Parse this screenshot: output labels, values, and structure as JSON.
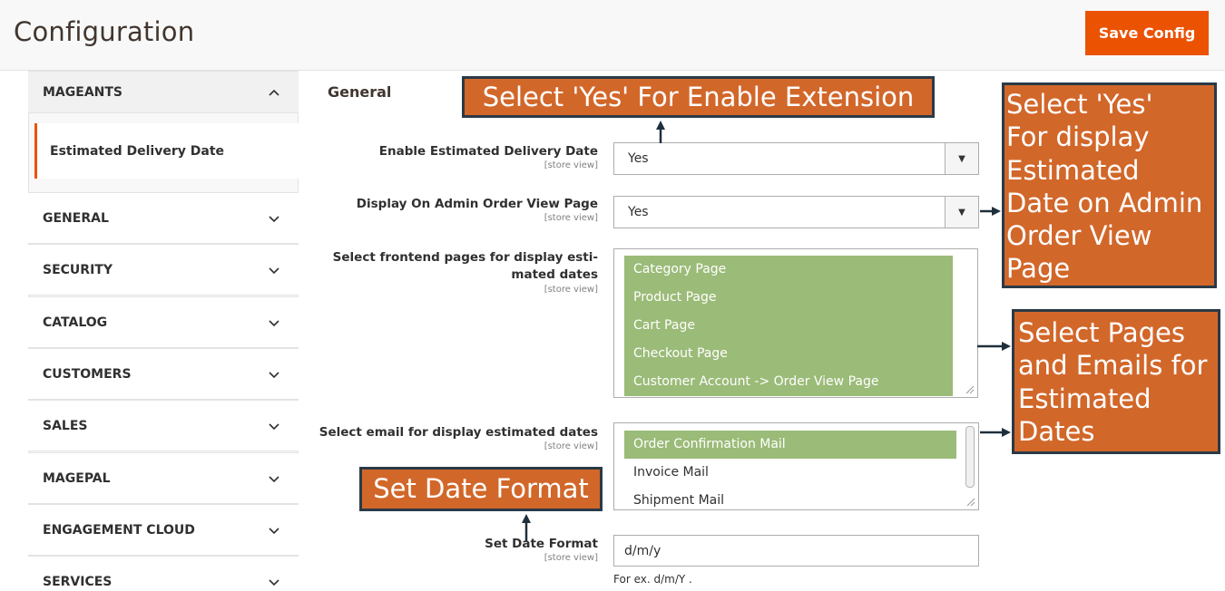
{
  "header": {
    "title": "Configuration",
    "save_label": "Save Config"
  },
  "sidebar": {
    "tabs": [
      {
        "label": "MAGEANTS",
        "expanded": true
      },
      {
        "label": "GENERAL"
      },
      {
        "label": "SECURITY"
      },
      {
        "label": "CATALOG"
      },
      {
        "label": "CUSTOMERS"
      },
      {
        "label": "SALES"
      },
      {
        "label": "MAGEPAL"
      },
      {
        "label": "ENGAGEMENT CLOUD"
      },
      {
        "label": "SERVICES"
      }
    ],
    "active_item": "Estimated Delivery Date"
  },
  "main": {
    "section_title": "General",
    "fields": {
      "enable": {
        "label": "Enable Estimated Delivery Date",
        "scope": "[store view]",
        "value": "Yes"
      },
      "admin_view": {
        "label": "Display On Admin Order View Page",
        "scope": "[store view]",
        "value": "Yes"
      },
      "pages": {
        "label_line1": "Select frontend pages for display esti-",
        "label_line2": "mated dates",
        "scope": "[store view]",
        "options": [
          "Category Page",
          "Product Page",
          "Cart Page",
          "Checkout Page",
          "Customer Account -> Order View Page"
        ]
      },
      "emails": {
        "label": "Select email for display estimated dates",
        "scope": "[store view]",
        "options": [
          "Order Confirmation Mail",
          "Invoice Mail",
          "Shipment Mail"
        ]
      },
      "date_format": {
        "label": "Set Date Format",
        "scope": "[store view]",
        "value": "d/m/y",
        "note": "For ex. d/m/Y ."
      }
    }
  },
  "callouts": {
    "enable": "Select 'Yes' For Enable Extension",
    "admin_lines": [
      "Select 'Yes'",
      "For display",
      "Estimated",
      "Date on Admin",
      "Order View",
      "Page"
    ],
    "pages_lines": [
      "Select Pages",
      "and Emails for",
      "Estimated",
      "Dates"
    ],
    "date_format": "Set Date Format"
  },
  "colors": {
    "accent": "#eb5202",
    "selected_option": "#9bbb78",
    "callout_bg": "#d2672a",
    "callout_border": "#2a3a47"
  }
}
